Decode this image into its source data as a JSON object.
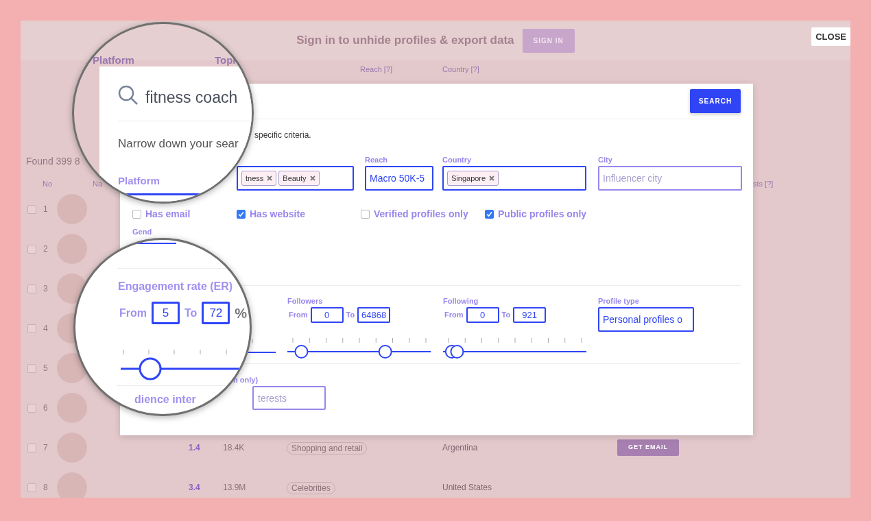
{
  "top_bar": {
    "message": "Sign in to unhide profiles & export data",
    "sign_in": "SIGN IN"
  },
  "close": "CLOSE",
  "background": {
    "filters": [
      {
        "label": "Reach [?]",
        "kind": "small"
      },
      {
        "label": "Country [?]",
        "kind": "small"
      }
    ],
    "found": "Found 399 8",
    "columns": [
      "No",
      "Na",
      "sts [?]"
    ],
    "rows": [
      {
        "no": "1",
        "checked": false
      },
      {
        "no": "2",
        "checked": false
      },
      {
        "no": "3",
        "checked": false
      },
      {
        "no": "4",
        "checked": false
      },
      {
        "no": "5",
        "checked": false
      },
      {
        "no": "6",
        "checked": false
      },
      {
        "no": "7",
        "checked": false,
        "er": "1.4",
        "followers": "18.4K",
        "topic": "Shopping and retail",
        "country": "Argentina",
        "action": "GET EMAIL"
      },
      {
        "no": "8",
        "checked": false,
        "er": "3.4",
        "followers": "13.9M",
        "topic": "Celebrities",
        "country": "United States"
      }
    ]
  },
  "modal": {
    "search_button": "SEARCH",
    "description": "specific criteria.",
    "topics": {
      "tags": [
        "tness",
        "Beauty"
      ]
    },
    "reach": {
      "label": "Reach",
      "value": "Macro 50K-5"
    },
    "country": {
      "label": "Country",
      "tags": [
        "Singapore"
      ]
    },
    "city": {
      "label": "City",
      "placeholder": "Influencer city"
    },
    "checkboxes": [
      {
        "label": "Has email",
        "checked": false
      },
      {
        "label": "Has website",
        "checked": true
      },
      {
        "label": "Verified profiles only",
        "checked": false
      },
      {
        "label": "Public profiles only",
        "checked": true
      }
    ],
    "gender": {
      "label": "Gend"
    },
    "followers": {
      "label": "Followers",
      "from_label": "From",
      "from": "0",
      "to_label": "To",
      "to": "64868",
      "thumbs": [
        {
          "level": 0.06
        },
        {
          "level": 0.7
        }
      ]
    },
    "following": {
      "label": "Following",
      "from_label": "From",
      "from": "0",
      "to_label": "To",
      "to": "921",
      "thumbs": [
        {
          "level": 0.02
        },
        {
          "level": 0.06
        }
      ]
    },
    "profile_type": {
      "label": "Profile type",
      "value": "Personal profiles o"
    },
    "interests": {
      "label": "n only)",
      "placeholder": "terests"
    }
  },
  "magnifiers": [
    {
      "kind": "search",
      "background_labels": [
        "Platform",
        "Topi"
      ],
      "search": "fitness coach",
      "description": "Narrow down your sear",
      "tabs": [
        {
          "label": "Platform",
          "selected": true
        }
      ]
    },
    {
      "kind": "engagement",
      "title": "Engagement rate (ER)",
      "from_label": "From",
      "from": "5",
      "to_label": "To",
      "to": "72",
      "unit": "%",
      "thumbs": [
        {
          "level": 0.17
        }
      ],
      "footer": "dience inter"
    }
  ]
}
